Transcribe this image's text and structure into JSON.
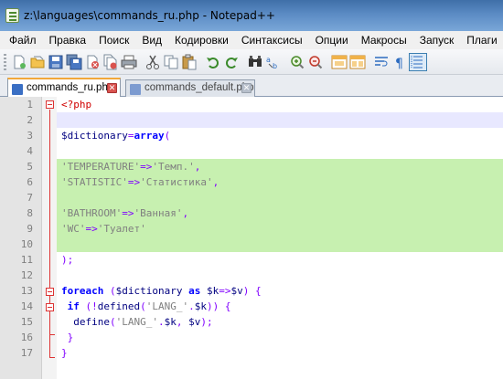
{
  "window": {
    "title": "z:\\languages\\commands_ru.php - Notepad++"
  },
  "menu": [
    "Файл",
    "Правка",
    "Поиск",
    "Вид",
    "Кодировки",
    "Синтаксисы",
    "Опции",
    "Макросы",
    "Запуск",
    "Плаги"
  ],
  "toolbar": {
    "icons": [
      "new-file-icon",
      "open-file-icon",
      "save-icon",
      "save-all-icon",
      "close-icon",
      "close-all-icon",
      "print-icon",
      "cut-icon",
      "copy-icon",
      "paste-icon",
      "undo-icon",
      "redo-icon",
      "find-icon",
      "replace-icon",
      "zoom-in-icon",
      "zoom-out-icon",
      "sync-vertical-icon",
      "sync-horizontal-icon",
      "word-wrap-icon",
      "show-all-chars-icon",
      "indent-guide-icon"
    ]
  },
  "tabs": [
    {
      "label": "commands_ru.php",
      "active": true
    },
    {
      "label": "commands_default.php",
      "active": false
    }
  ],
  "editor": {
    "lines": [
      {
        "n": "1",
        "tokens": [
          {
            "t": "<?php",
            "c": "k-php"
          }
        ]
      },
      {
        "n": "2",
        "tokens": []
      },
      {
        "n": "3",
        "tokens": [
          {
            "t": "$dictionary",
            "c": "k-var"
          },
          {
            "t": "=",
            "c": "k-op"
          },
          {
            "t": "array",
            "c": "k-kw"
          },
          {
            "t": "(",
            "c": "k-op"
          }
        ]
      },
      {
        "n": "4",
        "tokens": []
      },
      {
        "n": "5",
        "tokens": [
          {
            "t": "'TEMPERATURE'",
            "c": "k-str"
          },
          {
            "t": "=>",
            "c": "k-op"
          },
          {
            "t": "'Темп.'",
            "c": "k-str"
          },
          {
            "t": ",",
            "c": "k-op"
          }
        ]
      },
      {
        "n": "6",
        "tokens": [
          {
            "t": "'STATISTIC'",
            "c": "k-str"
          },
          {
            "t": "=>",
            "c": "k-op"
          },
          {
            "t": "'Статистика'",
            "c": "k-str"
          },
          {
            "t": ",",
            "c": "k-op"
          }
        ]
      },
      {
        "n": "7",
        "tokens": []
      },
      {
        "n": "8",
        "tokens": [
          {
            "t": "'BATHROOM'",
            "c": "k-str"
          },
          {
            "t": "=>",
            "c": "k-op"
          },
          {
            "t": "'Ванная'",
            "c": "k-str"
          },
          {
            "t": ",",
            "c": "k-op"
          }
        ]
      },
      {
        "n": "9",
        "tokens": [
          {
            "t": "'WC'",
            "c": "k-str"
          },
          {
            "t": "=>",
            "c": "k-op"
          },
          {
            "t": "'Туалет'",
            "c": "k-str"
          }
        ]
      },
      {
        "n": "10",
        "tokens": []
      },
      {
        "n": "11",
        "tokens": [
          {
            "t": ");",
            "c": "k-op"
          }
        ]
      },
      {
        "n": "12",
        "tokens": []
      },
      {
        "n": "13",
        "tokens": [
          {
            "t": "foreach",
            "c": "k-kw"
          },
          {
            "t": " (",
            "c": "k-op"
          },
          {
            "t": "$dictionary",
            "c": "k-var"
          },
          {
            "t": " as ",
            "c": "k-kw"
          },
          {
            "t": "$k",
            "c": "k-var"
          },
          {
            "t": "=>",
            "c": "k-op"
          },
          {
            "t": "$v",
            "c": "k-var"
          },
          {
            "t": ") {",
            "c": "k-op"
          }
        ]
      },
      {
        "n": "14",
        "tokens": [
          {
            "t": " if",
            "c": "k-kw"
          },
          {
            "t": " (!",
            "c": "k-op"
          },
          {
            "t": "defined",
            "c": "k-fn"
          },
          {
            "t": "(",
            "c": "k-op"
          },
          {
            "t": "'LANG_'",
            "c": "k-str"
          },
          {
            "t": ".",
            "c": "k-op"
          },
          {
            "t": "$k",
            "c": "k-var"
          },
          {
            "t": ")) {",
            "c": "k-op"
          }
        ]
      },
      {
        "n": "15",
        "tokens": [
          {
            "t": "  define",
            "c": "k-fn"
          },
          {
            "t": "(",
            "c": "k-op"
          },
          {
            "t": "'LANG_'",
            "c": "k-str"
          },
          {
            "t": ".",
            "c": "k-op"
          },
          {
            "t": "$k",
            "c": "k-var"
          },
          {
            "t": ", ",
            "c": "k-op"
          },
          {
            "t": "$v",
            "c": "k-var"
          },
          {
            "t": ");",
            "c": "k-op"
          }
        ]
      },
      {
        "n": "16",
        "tokens": [
          {
            "t": " }",
            "c": "k-op"
          }
        ]
      },
      {
        "n": "17",
        "tokens": [
          {
            "t": "}",
            "c": "k-op"
          }
        ]
      }
    ],
    "highlight_color": "#c7f0b0",
    "current_line_color": "#e8e8ff"
  }
}
